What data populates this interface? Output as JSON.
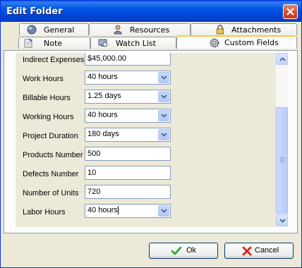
{
  "window": {
    "title": "Edit Folder"
  },
  "tabs": {
    "general": "General",
    "resources": "Resources",
    "attachments": "Attachments",
    "note": "Note",
    "watch_list": "Watch List",
    "custom_fields": "Custom Fields",
    "active": "Custom Fields"
  },
  "fields": [
    {
      "label": "Indirect Expenses",
      "value": "$45,000.00",
      "type": "text"
    },
    {
      "label": "Work Hours",
      "value": "40 hours",
      "type": "combo"
    },
    {
      "label": "Billable Hours",
      "value": "1.25 days",
      "type": "combo"
    },
    {
      "label": "Working Hours",
      "value": "40 hours",
      "type": "combo"
    },
    {
      "label": "Project Duration",
      "value": "180 days",
      "type": "combo"
    },
    {
      "label": "Products Number",
      "value": "500",
      "type": "text"
    },
    {
      "label": "Defects Number",
      "value": "10",
      "type": "text"
    },
    {
      "label": "Number of Units",
      "value": "720",
      "type": "text"
    },
    {
      "label": "Labor Hours",
      "value": "40 hours",
      "type": "combo"
    }
  ],
  "buttons": {
    "ok": "Ok",
    "cancel": "Cancel"
  },
  "colors": {
    "title_bar": "#0054e3",
    "ok_check": "#2e9e2e",
    "cancel_x": "#e02020",
    "active_tab_accent": "#ffc83c"
  },
  "icons": [
    "close-icon",
    "globe-icon",
    "person-icon",
    "lock-icon",
    "note-icon",
    "monitor-icon",
    "gear-icon",
    "checkmark-icon",
    "cross-icon"
  ]
}
